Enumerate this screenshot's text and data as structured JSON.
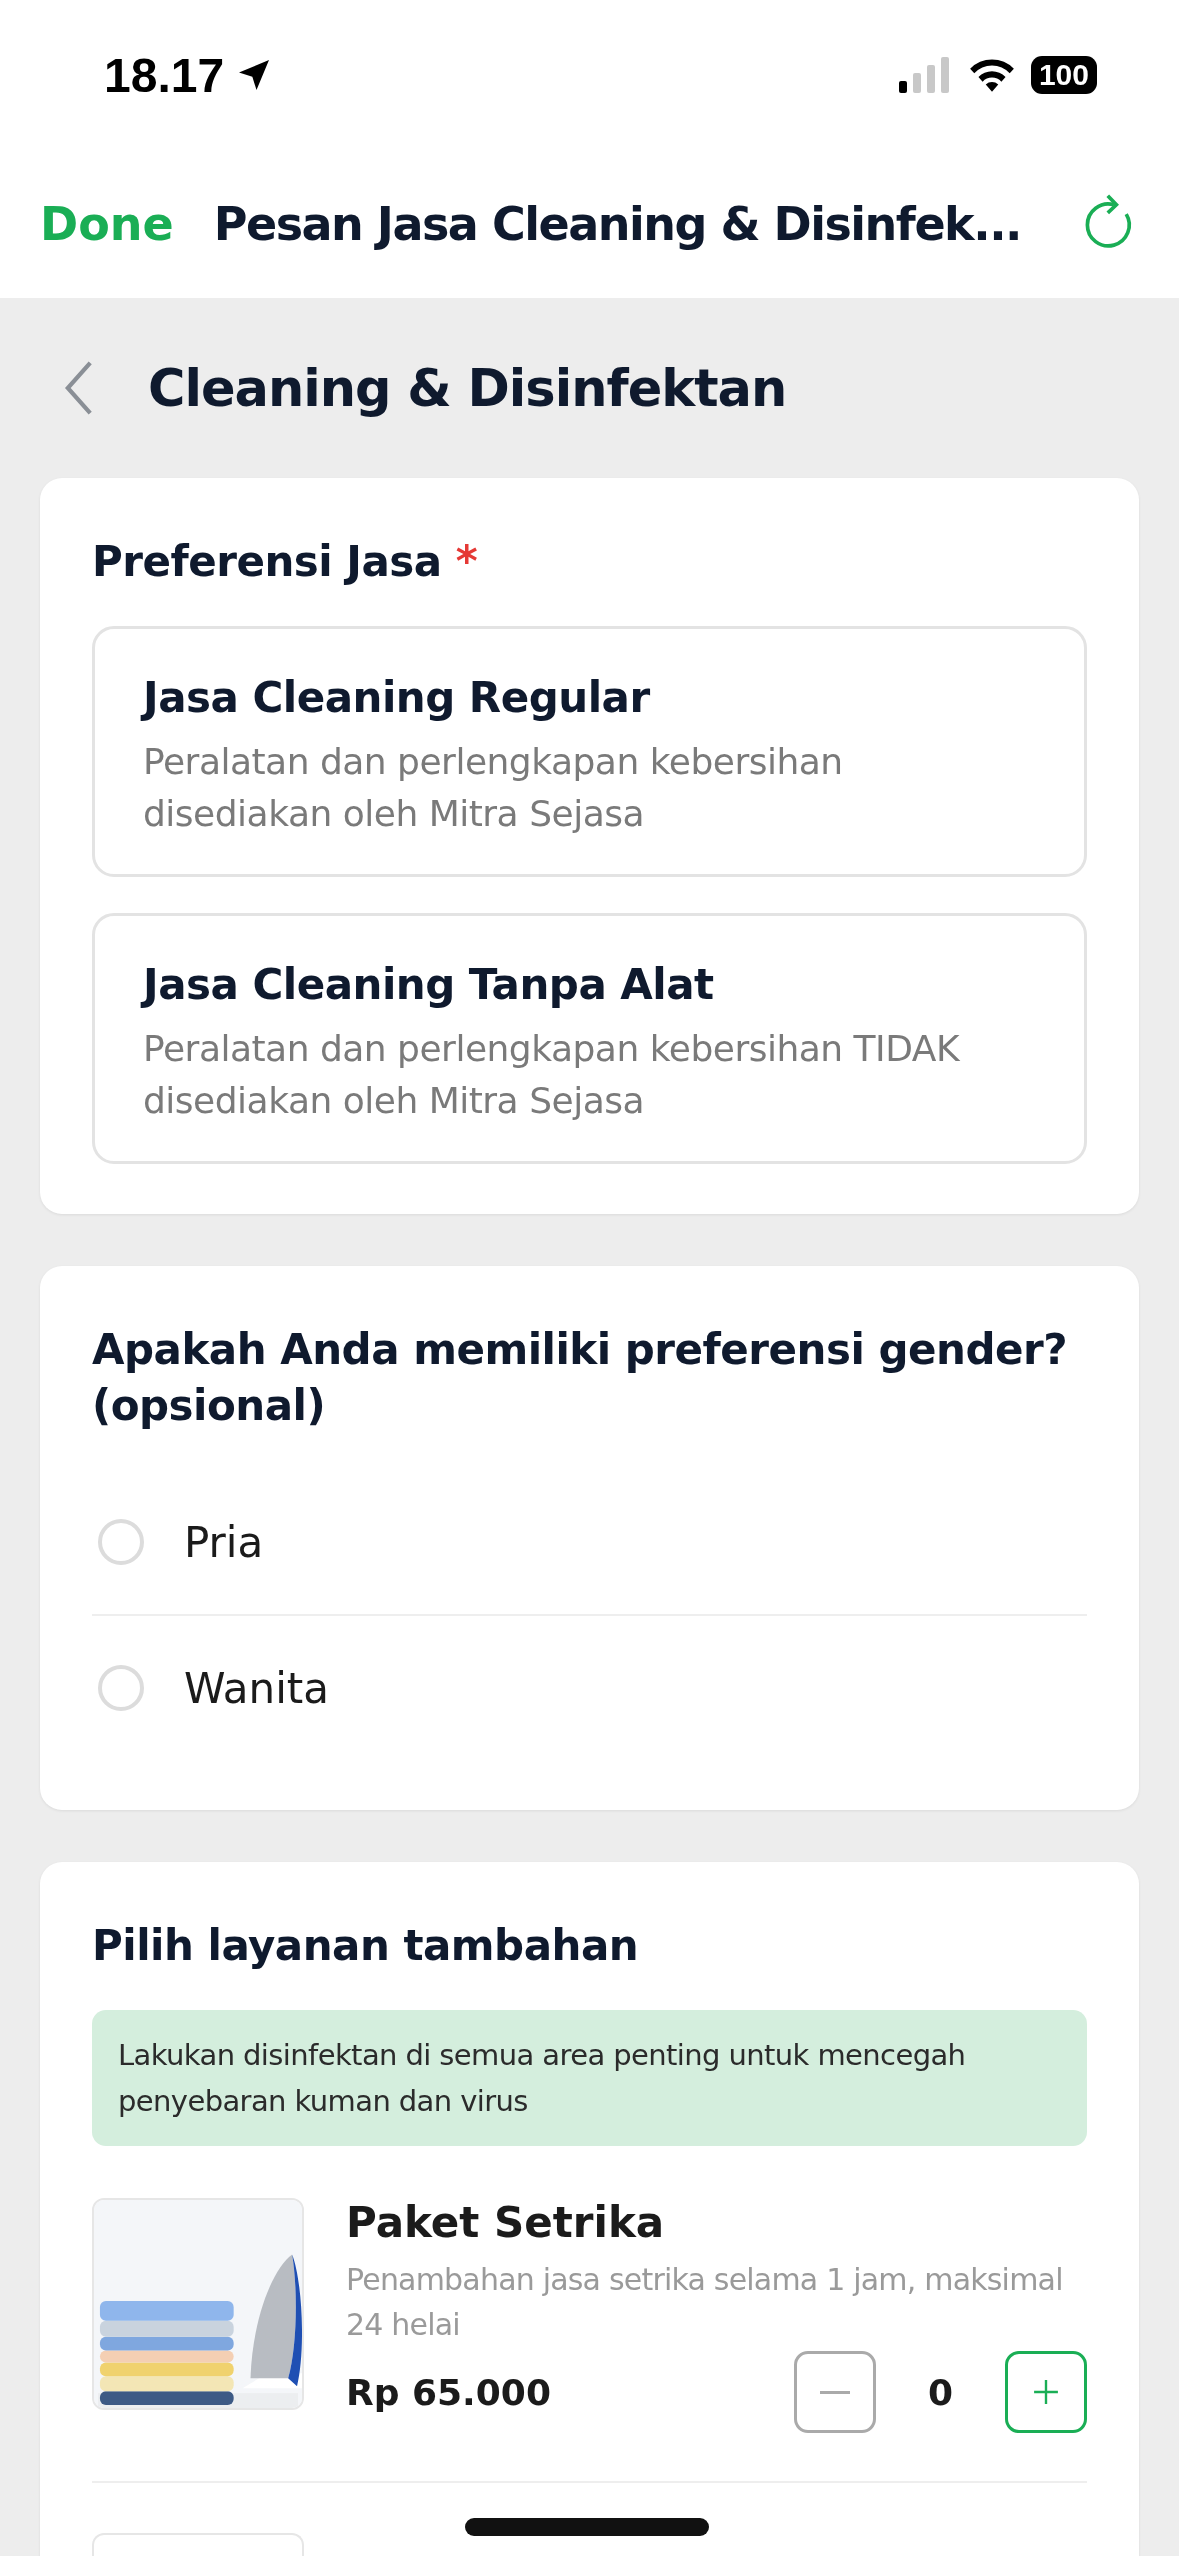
{
  "status_bar": {
    "time": "18.17",
    "battery": "100"
  },
  "nav_bar": {
    "done": "Done",
    "title": "Pesan Jasa Cleaning & Disinfek..."
  },
  "page_title": "Cleaning & Disinfektan",
  "service_preference": {
    "title": "Preferensi Jasa",
    "required_mark": "*",
    "options": [
      {
        "title": "Jasa Cleaning Regular",
        "description": "Peralatan dan perlengkapan kebersihan disediakan oleh Mitra Sejasa",
        "selected": false
      },
      {
        "title": "Jasa Cleaning Tanpa Alat",
        "description": "Peralatan dan perlengkapan kebersihan TIDAK disediakan oleh Mitra Sejasa",
        "selected": false
      }
    ]
  },
  "gender_preference": {
    "title": "Apakah Anda memiliki preferensi gender? (opsional)",
    "options": [
      {
        "label": "Pria",
        "selected": false
      },
      {
        "label": "Wanita",
        "selected": false
      }
    ]
  },
  "add_ons": {
    "title": "Pilih layanan tambahan",
    "notice": "Lakukan disinfektan di semua area penting untuk mencegah penyebaran kuman dan virus",
    "items": [
      {
        "kind": "picture",
        "name": "Paket Setrika",
        "description": "Penambahan jasa setrika selama 1 jam, maksimal 24 helai",
        "price": "Rp 65.000",
        "quantity": "0"
      }
    ]
  }
}
